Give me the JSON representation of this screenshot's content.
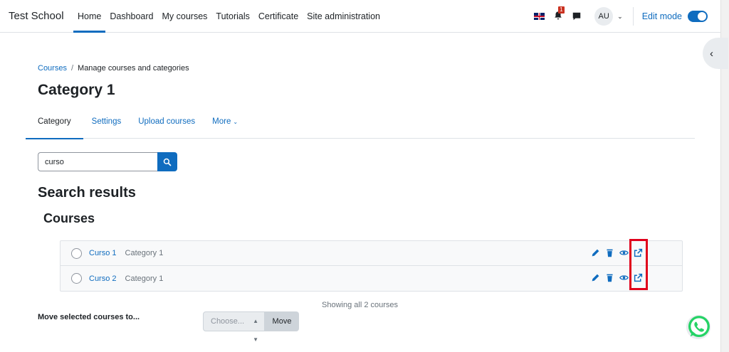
{
  "navbar": {
    "brand": "Test School",
    "links": [
      "Home",
      "Dashboard",
      "My courses",
      "Tutorials",
      "Certificate",
      "Site administration"
    ],
    "active_link": "Home",
    "notification_count": "1",
    "avatar_initials": "AU",
    "edit_mode_label": "Edit mode",
    "edit_mode_on": true
  },
  "breadcrumb": {
    "root": "Courses",
    "current": "Manage courses and categories"
  },
  "page_title": "Category 1",
  "tabs": [
    {
      "label": "Category",
      "active": true
    },
    {
      "label": "Settings",
      "active": false
    },
    {
      "label": "Upload courses",
      "active": false
    },
    {
      "label": "More",
      "active": false
    }
  ],
  "search": {
    "value": "curso"
  },
  "results_heading": "Search results",
  "courses_heading": "Courses",
  "courses": [
    {
      "name": "Curso 1",
      "category": "Category 1"
    },
    {
      "name": "Curso 2",
      "category": "Category 1"
    }
  ],
  "showing_text": "Showing all 2 courses",
  "move": {
    "label": "Move selected courses to...",
    "select_placeholder": "Choose...",
    "button_label": "Move"
  },
  "colors": {
    "primary": "#0f6cbf",
    "highlight": "#e0001b",
    "whatsapp": "#25d366"
  }
}
